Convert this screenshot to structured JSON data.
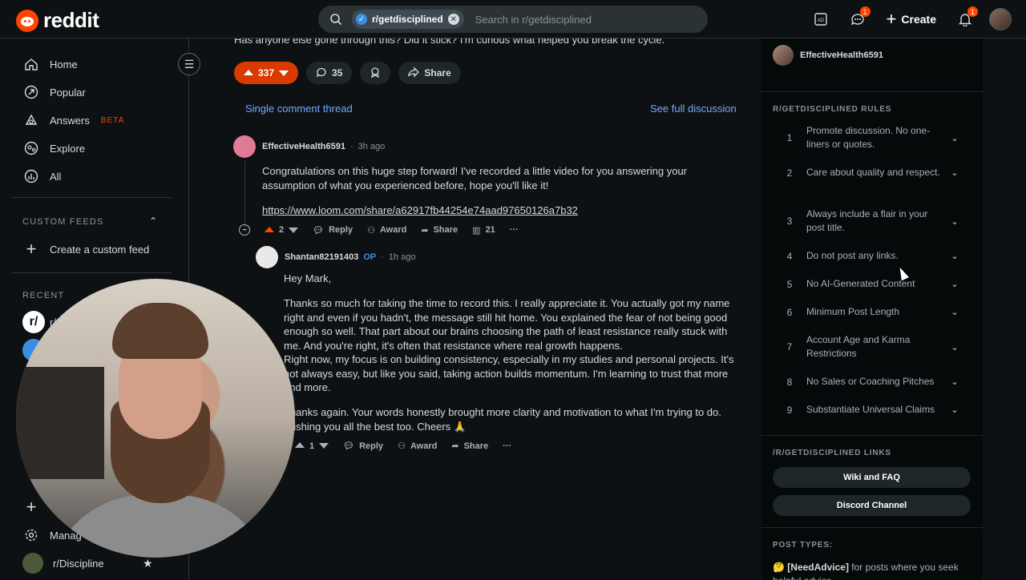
{
  "header": {
    "logo_text": "reddit",
    "search_chip": "r/getdisciplined",
    "search_placeholder": "Search in r/getdisciplined",
    "chat_badge": "1",
    "notif_badge": "1",
    "create_label": "Create"
  },
  "nav": {
    "home": "Home",
    "popular": "Popular",
    "answers": "Answers",
    "beta": "BETA",
    "explore": "Explore",
    "all": "All",
    "custom_feeds": "CUSTOM FEEDS",
    "create_feed": "Create a custom feed",
    "recent": "RECENT",
    "recent_1": "r/",
    "manage": "Manag",
    "community_last": "r/Discipline"
  },
  "post": {
    "cut_text": "Has anyone else gone through this? Did it stick? I'm curious what helped you break the cycle.",
    "votes": "337",
    "comments": "35",
    "share": "Share",
    "single_thread": "Single comment thread",
    "see_full": "See full discussion"
  },
  "comment1": {
    "user": "EffectiveHealth6591",
    "time": "3h ago",
    "body": "Congratulations on this huge step forward! I've recorded a little video for you answering your assumption of what you experienced before, hope you'll like it!",
    "link": "https://www.loom.com/share/a62917fb44254e74aad97650126a7b32",
    "votes": "2",
    "reply": "Reply",
    "award": "Award",
    "share": "Share",
    "views": "21"
  },
  "comment2": {
    "user": "Shantan82191403",
    "op": "OP",
    "time": "1h ago",
    "p1": "Hey Mark,",
    "p2": "Thanks so much for taking the time to record this. I really appreciate it. You actually got my name right and even if you hadn't, the message still hit home. You explained the fear of not being good enough so well. That part about our brains choosing the path of least resistance really stuck with me. And you're right, it's often that resistance where real growth happens.",
    "p3": "Right now, my focus is on building consistency, especially in my studies and personal projects. It's not always easy, but like you said, taking action builds momentum. I'm learning to trust that more and more.",
    "p4": "Thanks again. Your words honestly brought more clarity and motivation to what I'm trying to do. Wishing you all the best too. Cheers 🙏",
    "votes": "1",
    "reply": "Reply",
    "award": "Award",
    "share": "Share"
  },
  "sidebar": {
    "user": "EffectiveHealth6591",
    "rules_title": "R/GETDISCIPLINED RULES",
    "rules": [
      {
        "num": "1",
        "text": "Promote discussion. No one-liners or quotes."
      },
      {
        "num": "2",
        "text": "Care about quality and respect."
      },
      {
        "num": "3",
        "text": "Always include a flair in your post title."
      },
      {
        "num": "4",
        "text": "Do not post any links."
      },
      {
        "num": "5",
        "text": "No AI-Generated Content"
      },
      {
        "num": "6",
        "text": "Minimum Post Length"
      },
      {
        "num": "7",
        "text": "Account Age and Karma Restrictions"
      },
      {
        "num": "8",
        "text": "No Sales or Coaching Pitches"
      },
      {
        "num": "9",
        "text": "Substantiate Universal Claims"
      }
    ],
    "links_title": "/R/GETDISCIPLINED LINKS",
    "wiki": "Wiki and FAQ",
    "discord": "Discord Channel",
    "post_types_title": "POST TYPES:",
    "post_type_tag": "[NeedAdvice]",
    "post_type_text": " for posts where you seek helpful advice"
  }
}
